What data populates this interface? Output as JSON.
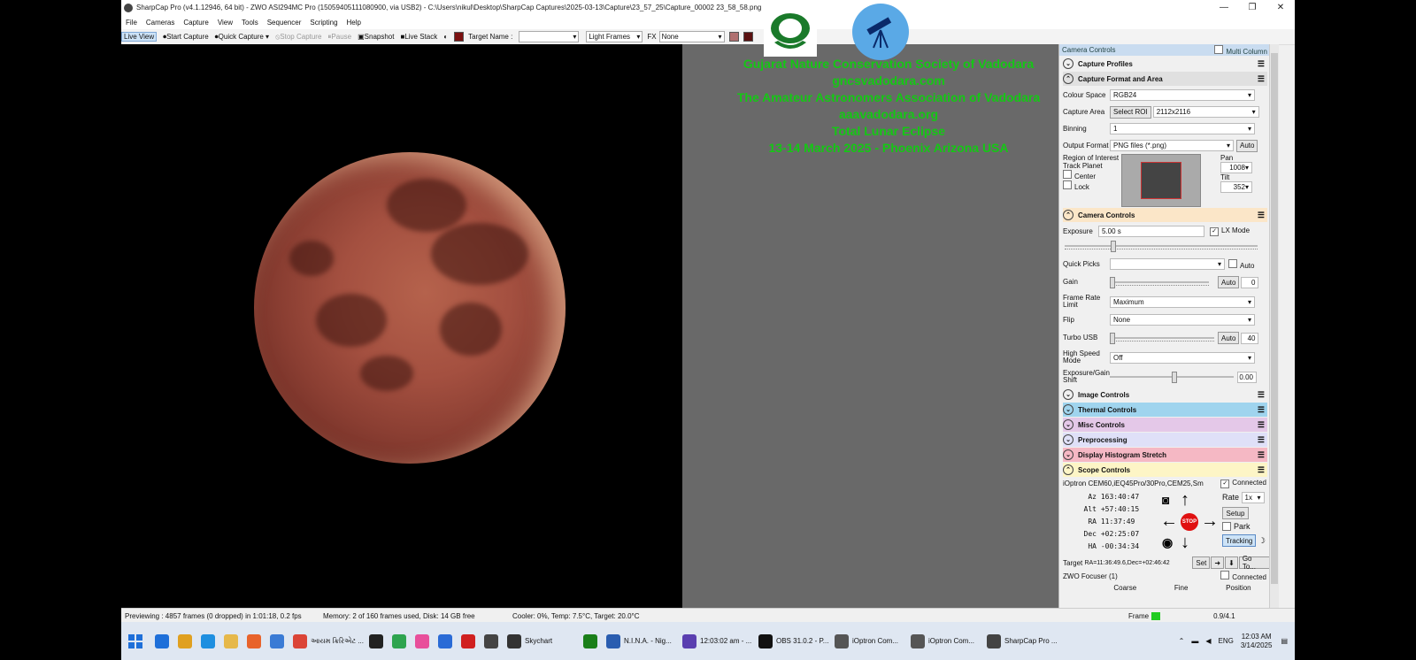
{
  "window": {
    "title": "SharpCap Pro (v4.1.12946, 64 bit) - ZWO ASI294MC Pro (15059405111080900, via USB2) - C:\\Users\\nikul\\Desktop\\SharpCap Captures\\2025-03-13\\Capture\\23_57_25\\Capture_00002 23_58_58.png",
    "minimize": "—",
    "maximize": "❐",
    "close": "✕"
  },
  "menu": [
    "File",
    "Cameras",
    "Capture",
    "View",
    "Tools",
    "Sequencer",
    "Scripting",
    "Help"
  ],
  "toolbar": {
    "live_view": "Live View",
    "start_capture": "Start Capture",
    "quick_capture": "Quick Capture",
    "stop_capture": "Stop Capture",
    "pause": "Pause",
    "snapshot": "Snapshot",
    "live_stack": "Live Stack",
    "target_name_label": "Target Name :",
    "frame_type": "Light Frames",
    "fx_label": "FX",
    "fx_value": "None"
  },
  "overlay_text": [
    "Gujarat Nature Conservation Society of Vadodara",
    "gncsvadodara.com",
    "The Amateur Astronomers Association of Vadodara",
    "aaavadodara.org",
    "Total Lunar Eclipse",
    "13-14 March 2025 - Phoenix Arizona USA"
  ],
  "side_panel": {
    "header": "Camera Controls",
    "multi_column": "Multi Column",
    "sections": {
      "capture_profiles": "Capture Profiles",
      "capture_format": "Capture Format and Area",
      "camera_controls": "Camera Controls",
      "image_controls": "Image Controls",
      "thermal_controls": "Thermal Controls",
      "misc_controls": "Misc Controls",
      "preprocessing": "Preprocessing",
      "display_histogram": "Display Histogram Stretch",
      "scope_controls": "Scope Controls"
    },
    "colour_space_label": "Colour Space",
    "colour_space_value": "RGB24",
    "capture_area_label": "Capture Area",
    "select_roi": "Select ROI",
    "capture_area_value": "2112x2116",
    "binning_label": "Binning",
    "binning_value": "1",
    "output_format_label": "Output Format",
    "output_format_value": "PNG files (*.png)",
    "auto": "Auto",
    "roi_label": "Region of Interest",
    "track_planet_label": "Track Planet",
    "center_label": "Center",
    "lock_label": "Lock",
    "pan_label": "Pan",
    "pan_value": "1008",
    "tilt_label": "Tilt",
    "tilt_value": "352",
    "exposure_label": "Exposure",
    "exposure_value": "5.00 s",
    "lx_mode": "LX Mode",
    "quick_picks_label": "Quick Picks",
    "gain_label": "Gain",
    "gain_value": "0",
    "frame_rate_label": "Frame Rate Limit",
    "frame_rate_value": "Maximum",
    "flip_label": "Flip",
    "flip_value": "None",
    "turbo_usb_label": "Turbo USB",
    "turbo_usb_value": "40",
    "high_speed_label": "High Speed Mode",
    "high_speed_value": "Off",
    "exp_gain_shift_label": "Exposure/Gain Shift",
    "exp_gain_shift_value": "0.00",
    "mount_name": "iOptron CEM60,iEQ45Pro/30Pro,CEM25,Sm",
    "connected": "Connected",
    "coords": [
      {
        "label": "Az",
        "value": "163:40:47"
      },
      {
        "label": "Alt",
        "value": "+57:40:15"
      },
      {
        "label": "RA",
        "value": "11:37:49"
      },
      {
        "label": "Dec",
        "value": "+02:25:07"
      },
      {
        "label": "HA",
        "value": "-00:34:34"
      }
    ],
    "rate_label": "Rate",
    "rate_value": "1x",
    "setup": "Setup",
    "park": "Park",
    "tracking": "Tracking",
    "stop": "STOP",
    "target_label": "Target",
    "target_value": "RA=11:36:49.6,Dec=+02:46:42",
    "set": "Set",
    "goto": "Go To...",
    "focuser_name": "ZWO Focuser (1)",
    "focuser_connected": "Connected",
    "coarse": "Coarse",
    "fine": "Fine",
    "position": "Position"
  },
  "status_bar": {
    "previewing": "Previewing : 4857 frames (0 dropped) in 1:01:18, 0.2 fps",
    "memory": "Memory: 2 of 160 frames used, Disk: 14 GB free",
    "cooler": "Cooler: 0%, Temp: 7.5°C, Target: 20.0°C",
    "frame_label": "Frame",
    "frame_value": "0.9/4.1"
  },
  "taskbar": {
    "items": [
      {
        "label": "",
        "color": "#1e6fd9"
      },
      {
        "label": "",
        "color": "#e0a020"
      },
      {
        "label": "",
        "color": "#1e8fe0"
      },
      {
        "label": "",
        "color": "#e6b84a"
      },
      {
        "label": "",
        "color": "#e8632b"
      },
      {
        "label": "",
        "color": "#3a7bd5"
      },
      {
        "label": "આયમ ક્રિરિએટ ...",
        "color": "#db4437"
      },
      {
        "label": "",
        "color": "#222"
      },
      {
        "label": "",
        "color": "#2ea44f"
      },
      {
        "label": "",
        "color": "#e84f9b"
      },
      {
        "label": "",
        "color": "#2a6bd6"
      },
      {
        "label": "",
        "color": "#d02020"
      },
      {
        "label": "",
        "color": "#444"
      },
      {
        "label": "Skychart",
        "color": "#333"
      },
      {
        "label": "",
        "color": "#1a7f1a"
      },
      {
        "label": "N.I.N.A. - Nig...",
        "color": "#2a5db0"
      },
      {
        "label": "12:03:02 am - ...",
        "color": "#5a3fb0"
      },
      {
        "label": "OBS 31.0.2 - P...",
        "color": "#111"
      },
      {
        "label": "iOptron Com...",
        "color": "#555"
      },
      {
        "label": "iOptron Com...",
        "color": "#555"
      },
      {
        "label": "SharpCap Pro ...",
        "color": "#444"
      }
    ],
    "lang": "ENG",
    "time": "12:03 AM",
    "date": "3/14/2025"
  },
  "colors": {
    "overlay_green": "#14c814",
    "thermal": "#9fd4ee",
    "misc": "#e4c8e8",
    "preprocessing": "#dfe0f8",
    "histogram": "#f5b8c4",
    "scope": "#fdf5c6",
    "camera_controls": "#fbe6c8",
    "capture_format": "#e0e0e0"
  }
}
